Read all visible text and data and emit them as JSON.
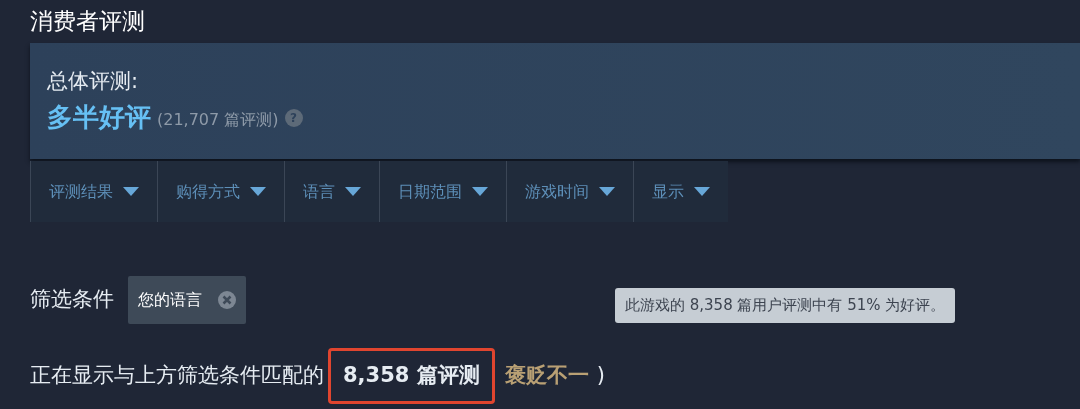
{
  "section_title": "消费者评测",
  "summary": {
    "label": "总体评测:",
    "rating": "多半好评",
    "count": "(21,707 篇评测)",
    "help": "?"
  },
  "filters": [
    {
      "label": "评测结果"
    },
    {
      "label": "购得方式"
    },
    {
      "label": "语言"
    },
    {
      "label": "日期范围"
    },
    {
      "label": "游戏时间"
    },
    {
      "label": "显示"
    }
  ],
  "active_filters": {
    "label": "筛选条件",
    "chips": [
      {
        "label": "您的语言"
      }
    ]
  },
  "result": {
    "text": "正在显示与上方筛选条件匹配的",
    "count": "8,358 篇评测",
    "rating": "褒贬不一",
    "close_paren": ")",
    "highlighted": true
  },
  "tooltip": "此游戏的 8,358 篇用户评测中有 51% 为好评。"
}
